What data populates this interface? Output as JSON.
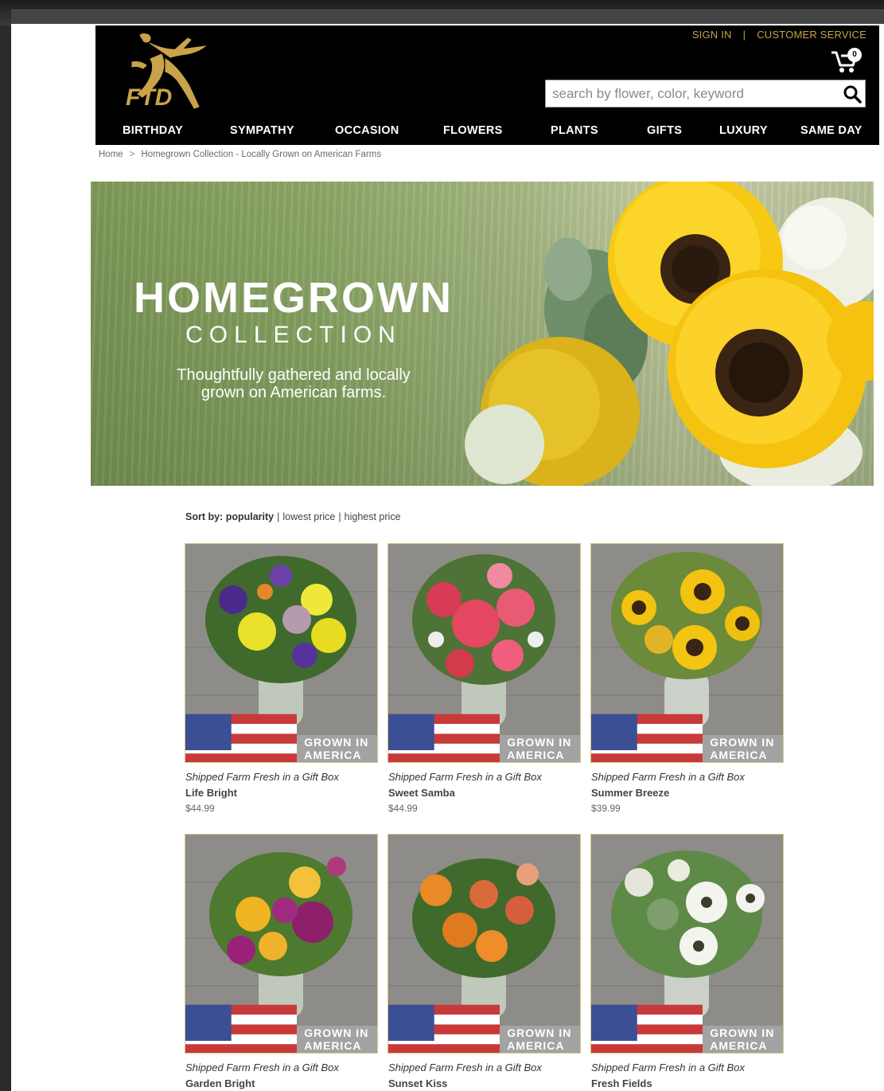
{
  "header": {
    "sign_in": "SIGN IN",
    "separator": "|",
    "customer_service": "CUSTOMER SERVICE",
    "cart_count": "0",
    "search_placeholder": "search by flower, color, keyword",
    "logo_text": "FTD"
  },
  "nav": [
    {
      "label": "BIRTHDAY"
    },
    {
      "label": "SYMPATHY"
    },
    {
      "label": "OCCASION"
    },
    {
      "label": "FLOWERS"
    },
    {
      "label": "PLANTS"
    },
    {
      "label": "GIFTS"
    },
    {
      "label": "LUXURY"
    },
    {
      "label": "SAME DAY"
    }
  ],
  "breadcrumb": {
    "home": "Home",
    "sep": ">",
    "current": "Homegrown Collection - Locally Grown on American Farms"
  },
  "hero": {
    "title": "HOMEGROWN",
    "subtitle": "COLLECTION",
    "line1": "Thoughtfully gathered and locally",
    "line2": "grown on American farms."
  },
  "sort": {
    "label": "Sort by:",
    "options": [
      "popularity",
      "lowest price",
      "highest price"
    ]
  },
  "badge_text": "GROWN IN AMERICA",
  "products": [
    {
      "ship": "Shipped Farm Fresh in a Gift Box",
      "name": "Life Bright",
      "price": "$44.99"
    },
    {
      "ship": "Shipped Farm Fresh in a Gift Box",
      "name": "Sweet Samba",
      "price": "$44.99"
    },
    {
      "ship": "Shipped Farm Fresh in a Gift Box",
      "name": "Summer Breeze",
      "price": "$39.99"
    },
    {
      "ship": "Shipped Farm Fresh in a Gift Box",
      "name": "Garden Bright",
      "price": ""
    },
    {
      "ship": "Shipped Farm Fresh in a Gift Box",
      "name": "Sunset Kiss",
      "price": ""
    },
    {
      "ship": "Shipped Farm Fresh in a Gift Box",
      "name": "Fresh Fields",
      "price": ""
    }
  ],
  "colors": {
    "header_bg": "#000000",
    "gold": "#c9a24a",
    "badge_bg": "#a3a3a3"
  }
}
